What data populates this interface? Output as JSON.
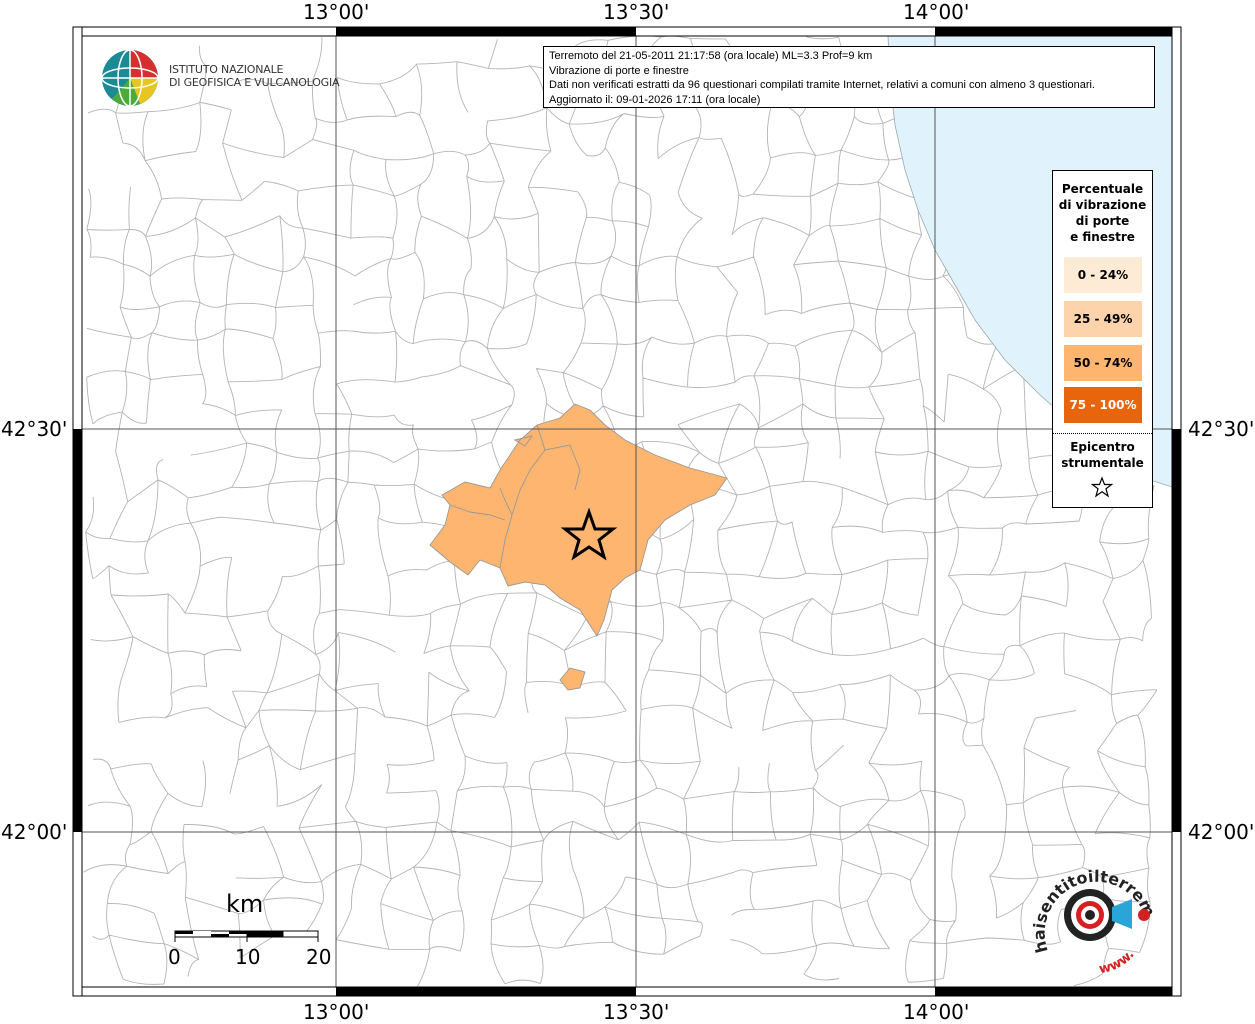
{
  "map": {
    "top_ticks": [
      "13°00'",
      "13°30'",
      "14°00'"
    ],
    "bottom_ticks": [
      "13°00'",
      "13°30'",
      "14°00'"
    ],
    "left_ticks": [
      "42°30'",
      "42°00'"
    ],
    "right_ticks": [
      "42°30'",
      "42°00'"
    ],
    "sea_color": "#e0f2fc",
    "affected_color": "#fdb56f"
  },
  "info": {
    "line1": "Terremoto del 21-05-2011 21:17:58 (ora locale) ML=3.3 Prof=9 km",
    "line2": "Vibrazione di porte e finestre",
    "line3": "Dati non verificati estratti da 96 questionari compilati tramite Internet, relativi a comuni con almeno 3 questionari.",
    "line4": "Aggiornato il: 09-01-2026 17:11 (ora locale)"
  },
  "legend": {
    "title_lines": [
      "Percentuale",
      "di vibrazione",
      "di porte",
      "e finestre"
    ],
    "items": [
      {
        "label": "0 - 24%",
        "color": "#fdebd6"
      },
      {
        "label": "25 - 49%",
        "color": "#fdd3ab"
      },
      {
        "label": "50 - 74%",
        "color": "#fdb56f"
      },
      {
        "label": "75 - 100%",
        "color": "#e8650c"
      }
    ],
    "epicenter_lines": [
      "Epicentro",
      "strumentale"
    ],
    "epicenter_icon": "star-outline-icon"
  },
  "scale": {
    "title": "km",
    "labels": [
      "0",
      "10",
      "20"
    ]
  },
  "logos": {
    "ingv_line1": "ISTITUTO NAZIONALE",
    "ingv_line2": "DI GEOFISICA E VULCANOLOGIA",
    "hsit_text": "haisentitoilterremoto.it",
    "hsit_www": "www."
  }
}
